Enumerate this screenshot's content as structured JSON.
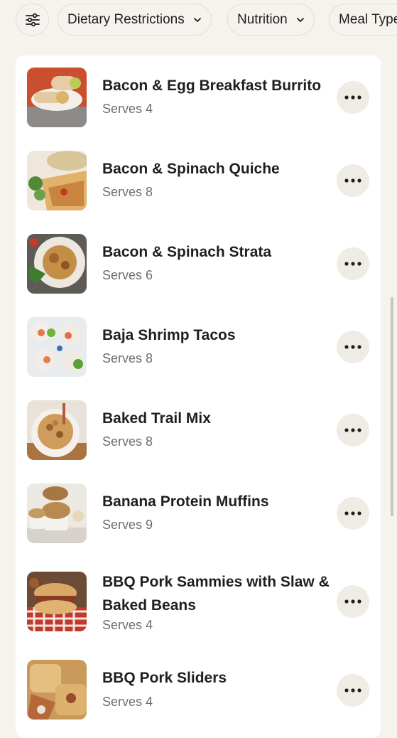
{
  "filters": {
    "chips": [
      {
        "label": "Dietary Restrictions"
      },
      {
        "label": "Nutrition"
      },
      {
        "label": "Meal Type"
      }
    ]
  },
  "recipes": [
    {
      "title": "Bacon & Egg Breakfast Burrito",
      "serves": "Serves 4"
    },
    {
      "title": "Bacon & Spinach Quiche",
      "serves": "Serves 8"
    },
    {
      "title": "Bacon & Spinach Strata",
      "serves": "Serves 6"
    },
    {
      "title": "Baja Shrimp Tacos",
      "serves": "Serves 8"
    },
    {
      "title": "Baked Trail Mix",
      "serves": "Serves 8"
    },
    {
      "title": "Banana Protein Muffins",
      "serves": "Serves 9"
    },
    {
      "title": "BBQ Pork Sammies with Slaw & Baked Beans",
      "serves": "Serves 4"
    },
    {
      "title": "BBQ Pork Sliders",
      "serves": "Serves 4"
    }
  ],
  "colors": {
    "page_background": "#f6f3ee",
    "card_background": "#ffffff",
    "more_button": "#efece6"
  }
}
